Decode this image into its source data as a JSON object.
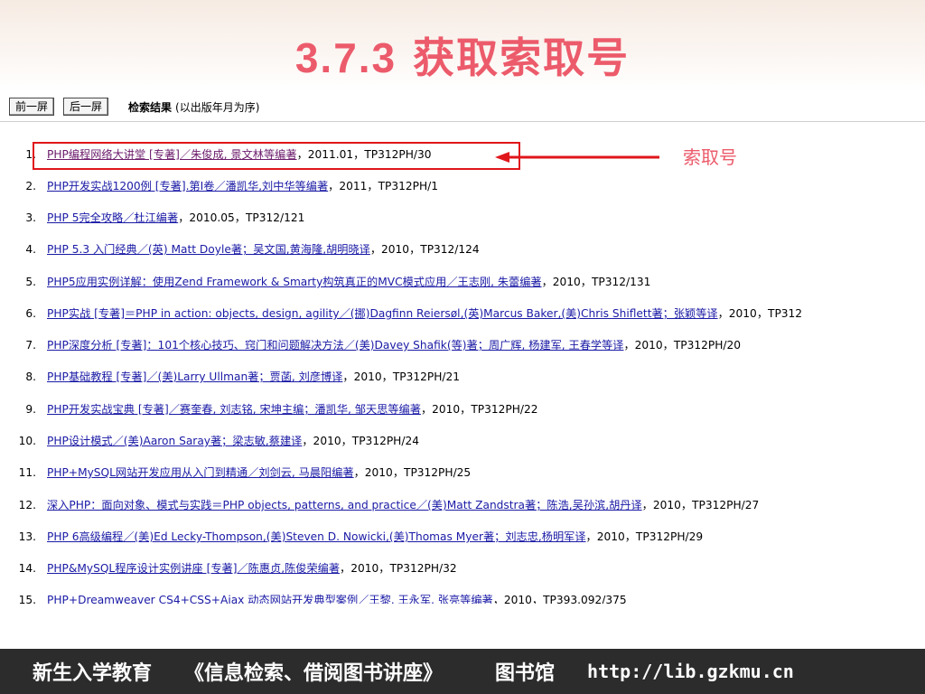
{
  "slide": {
    "title_number": "3.7.3",
    "title_text": " 获取索取号"
  },
  "toolbar": {
    "prev_label": "前一屏",
    "next_label": "后一屏",
    "results_label": "检索结果",
    "sort_note": "(以出版年月为序)"
  },
  "callout": {
    "label": "索取号"
  },
  "results": [
    {
      "index": "1.",
      "title": "PHP编程网络大讲堂 [专著]／朱俊成, 景文林等编著",
      "rest": "，2011.01，TP312PH/30",
      "visited": true
    },
    {
      "index": "2.",
      "title": "PHP开发实战1200例 [专著].第Ⅰ卷／潘凯华,刘中华等编著",
      "rest": "，2011，TP312PH/1",
      "visited": false
    },
    {
      "index": "3.",
      "title": "PHP 5完全攻略／杜江编著",
      "rest": "，2010.05，TP312/121",
      "visited": false
    },
    {
      "index": "4.",
      "title": "PHP 5.3 入门经典／(英) Matt Doyle著；吴文国,黄海隆,胡明晓译",
      "rest": "，2010，TP312/124",
      "visited": false
    },
    {
      "index": "5.",
      "title": "PHP5应用实例详解：使用Zend Framework & Smarty构筑真正的MVC模式应用／王志刚, 朱蕾编著",
      "rest": "，2010，TP312/131",
      "visited": false
    },
    {
      "index": "6.",
      "title": "PHP实战 [专著]＝PHP in action: objects, design, agility／(挪)Dagfinn Reiersøl,(英)Marcus Baker,(美)Chris Shiflett著；张颖等译",
      "rest": "，2010，TP312",
      "visited": false
    },
    {
      "index": "7.",
      "title": "PHP深度分析 [专著]：101个核心技巧、窍门和问题解决方法／(美)Davey Shafik(等)著；周广辉, 杨建军, 王春学等译",
      "rest": "，2010，TP312PH/20",
      "visited": false
    },
    {
      "index": "8.",
      "title": "PHP基础教程 [专著]／(美)Larry Ullman著；贾菡, 刘彦博译",
      "rest": "，2010，TP312PH/21",
      "visited": false
    },
    {
      "index": "9.",
      "title": "PHP开发实战宝典 [专著]／赛奎春, 刘志铭, 宋坤主编；潘凯华, 邹天思等编著",
      "rest": "，2010，TP312PH/22",
      "visited": false
    },
    {
      "index": "10.",
      "title": "PHP设计模式／(美)Aaron Saray著；梁志敏,蔡建译",
      "rest": "，2010，TP312PH/24",
      "visited": false
    },
    {
      "index": "11.",
      "title": "PHP+MySQL网站开发应用从入门到精通／刘剑云, 马晨阳编著",
      "rest": "，2010，TP312PH/25",
      "visited": false
    },
    {
      "index": "12.",
      "title": "深入PHP：面向对象、模式与实践＝PHP objects, patterns, and practice／(美)Matt Zandstra著；陈浩,吴孙滨,胡丹译",
      "rest": "，2010，TP312PH/27",
      "visited": false
    },
    {
      "index": "13.",
      "title": "PHP 6高级编程／(美)Ed Lecky-Thompson,(美)Steven D. Nowicki,(美)Thomas Myer著；刘志忠,杨明军译",
      "rest": "，2010，TP312PH/29",
      "visited": false
    },
    {
      "index": "14.",
      "title": "PHP&MySQL程序设计实例讲座 [专著]／陈惠贞,陈俊荣编著",
      "rest": "，2010，TP312PH/32",
      "visited": false
    },
    {
      "index": "15.",
      "title": "PHP+Dreamweaver CS4+CSS+Ajax 动态网站开发典型案例／王黎, 王永军, 张亮等编著",
      "rest": "，2010，TP393.092/375",
      "visited": false
    }
  ],
  "footer": {
    "part1": "新生入学教育",
    "part2": "《信息检索、借阅图书讲座》",
    "part3": "图书馆",
    "part4": "http://lib.gzkmu.cn"
  },
  "colors": {
    "title": "#ec5b6b",
    "highlight_box": "#e0161b",
    "link": "#1a1aa6",
    "visited_link": "#6b1b6b",
    "footer_bg": "#2c2c2c"
  }
}
